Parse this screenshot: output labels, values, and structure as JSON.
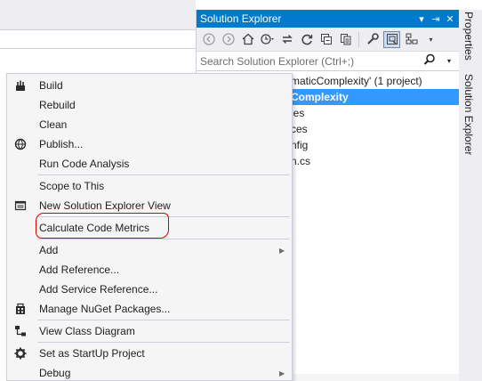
{
  "solution_explorer": {
    "title": "Solution Explorer",
    "title_buttons": [
      "▾",
      "⇥",
      "✕"
    ],
    "toolbar_icons": [
      "back-arrow-icon",
      "forward-arrow-icon",
      "home-icon",
      "history-icon",
      "sync-icon",
      "refresh-icon",
      "collapse-all-icon",
      "show-all-files-icon",
      "properties-wrench-icon",
      "preview-icon",
      "class-view-icon"
    ],
    "search_placeholder": "Search Solution Explorer (Ctrl+;)",
    "tree_items": [
      "maticComplexity' (1 project)",
      "Complexity",
      "ies",
      "ces",
      "nfig",
      "n.cs"
    ]
  },
  "side_tabs": [
    "Properties",
    "Solution Explorer"
  ],
  "context_menu": {
    "items": [
      {
        "label": "Build",
        "icon": "build-icon",
        "submenu": false
      },
      {
        "label": "Rebuild",
        "icon": "",
        "submenu": false
      },
      {
        "label": "Clean",
        "icon": "",
        "submenu": false
      },
      {
        "label": "Publish...",
        "icon": "publish-globe-icon",
        "submenu": false
      },
      {
        "label": "Run Code Analysis",
        "icon": "",
        "submenu": false
      },
      {
        "label": "Scope to This",
        "icon": "",
        "submenu": false
      },
      {
        "label": "New Solution Explorer View",
        "icon": "new-window-icon",
        "submenu": false
      },
      {
        "label": "Calculate Code Metrics",
        "icon": "",
        "submenu": false
      },
      {
        "label": "Add",
        "icon": "",
        "submenu": true
      },
      {
        "label": "Add Reference...",
        "icon": "",
        "submenu": false
      },
      {
        "label": "Add Service Reference...",
        "icon": "",
        "submenu": false
      },
      {
        "label": "Manage NuGet Packages...",
        "icon": "nuget-icon",
        "submenu": false
      },
      {
        "label": "View Class Diagram",
        "icon": "class-diagram-icon",
        "submenu": false
      },
      {
        "label": "Set as StartUp Project",
        "icon": "gear-icon",
        "submenu": false
      },
      {
        "label": "Debug",
        "icon": "",
        "submenu": true
      }
    ],
    "highlight_color": "#d40000"
  },
  "colors": {
    "titlebar": "#007acc",
    "selection": "#3399ff"
  }
}
